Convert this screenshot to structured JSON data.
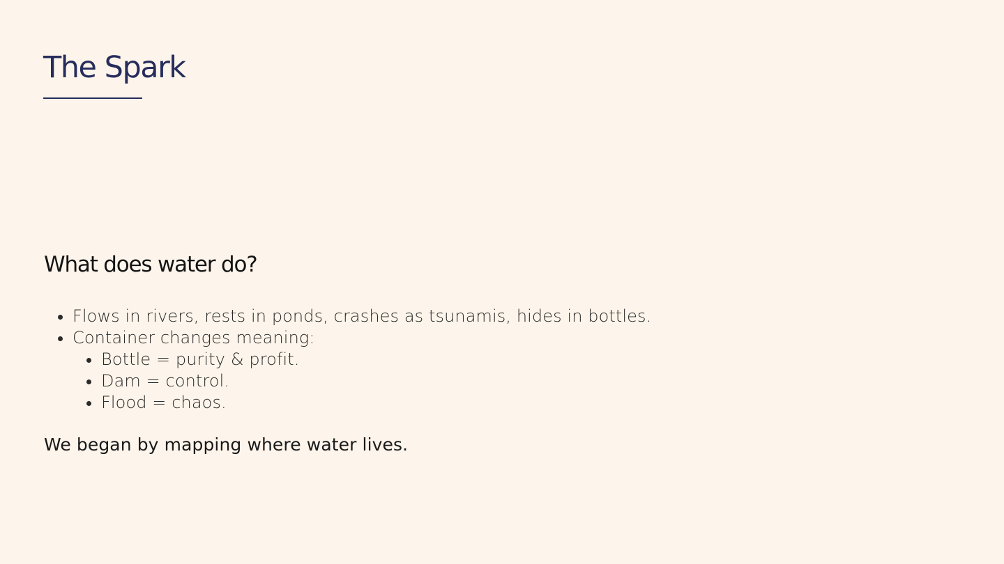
{
  "slide": {
    "title": "The Spark",
    "question": "What does water do?",
    "points": [
      "Flows in rivers, rests in ponds, crashes as tsunamis, hides in bottles.",
      "Container changes meaning:"
    ],
    "subpoints": [
      "Bottle = purity & profit.",
      "Dam = control.",
      "Flood = chaos."
    ],
    "closing": "We began by mapping where water lives."
  },
  "colors": {
    "background": "#fdf5eb",
    "title": "#262d5c",
    "text": "#1f1f1f"
  }
}
